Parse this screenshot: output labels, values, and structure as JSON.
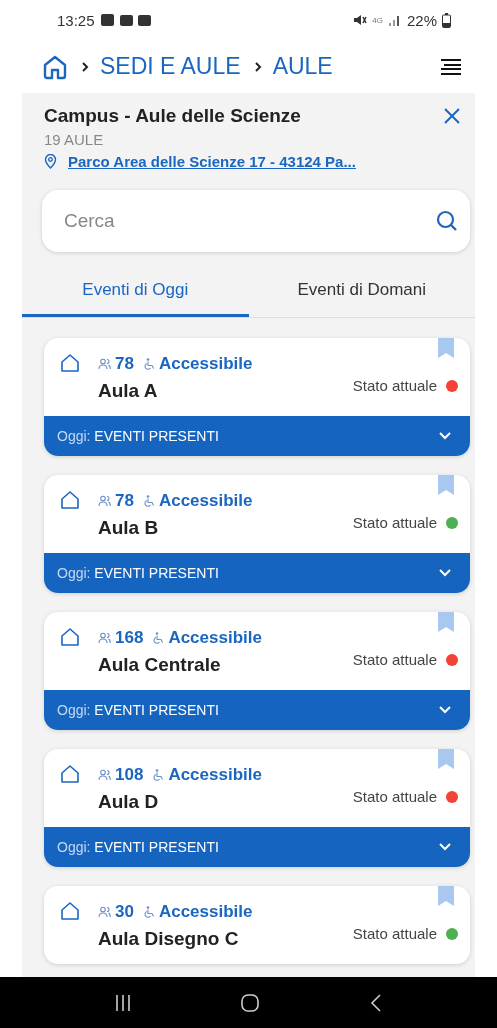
{
  "status_bar": {
    "time": "13:25",
    "network": "4G",
    "battery": "22%"
  },
  "breadcrumb": [
    "SEDI E AULE",
    "AULE"
  ],
  "campus": {
    "title": "Campus - Aule delle Scienze",
    "count": "19 AULE",
    "address": "Parco Area delle Scienze 17 - 43124 Pa..."
  },
  "search": {
    "placeholder": "Cerca"
  },
  "tabs": [
    {
      "label": "Eventi di Oggi",
      "selected": true
    },
    {
      "label": "Eventi di Domani",
      "selected": false
    }
  ],
  "rooms": [
    {
      "capacity": "78",
      "access": "Accessibile",
      "name": "Aula A",
      "status_label": "Stato attuale",
      "color": "#f44336",
      "today_label": "Oggi:",
      "today_value": "EVENTI PRESENTI"
    },
    {
      "capacity": "78",
      "access": "Accessibile",
      "name": "Aula B",
      "status_label": "Stato attuale",
      "color": "#4caf50",
      "today_label": "Oggi:",
      "today_value": "EVENTI PRESENTI"
    },
    {
      "capacity": "168",
      "access": "Accessibile",
      "name": "Aula Centrale",
      "status_label": "Stato attuale",
      "color": "#f44336",
      "today_label": "Oggi:",
      "today_value": "EVENTI PRESENTI"
    },
    {
      "capacity": "108",
      "access": "Accessibile",
      "name": "Aula D",
      "status_label": "Stato attuale",
      "color": "#f44336",
      "today_label": "Oggi:",
      "today_value": "EVENTI PRESENTI"
    },
    {
      "capacity": "30",
      "access": "Accessibile",
      "name": "Aula Disegno C",
      "status_label": "Stato attuale",
      "color": "#4caf50"
    }
  ]
}
